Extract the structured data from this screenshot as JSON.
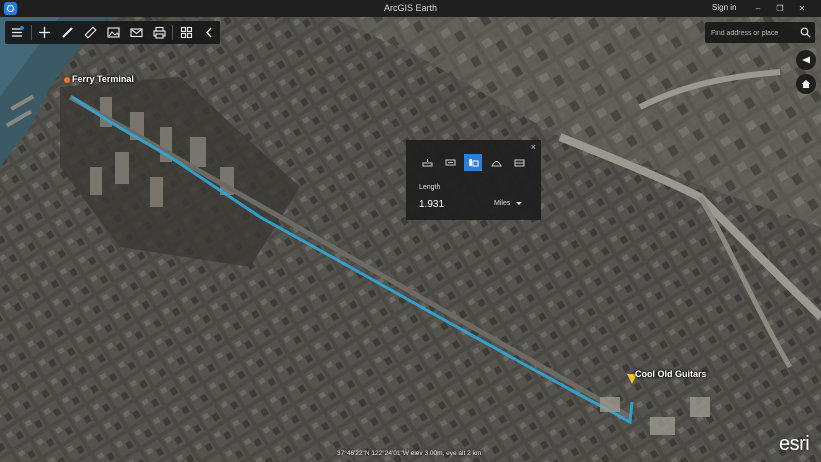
{
  "window": {
    "title": "ArcGIS Earth",
    "sign_in": "Sign in",
    "minimize_glyph": "–",
    "restore_glyph": "❐",
    "close_glyph": "✕"
  },
  "toolbar": {
    "icons": [
      "layers-icon",
      "add-icon",
      "draw-icon",
      "measure-icon",
      "image-icon",
      "mail-icon",
      "print-icon",
      "grid-icon",
      "collapse-icon"
    ]
  },
  "search": {
    "placeholder": "Find address or place"
  },
  "map": {
    "labels": {
      "start": "Ferry Terminal",
      "end": "Cool Old Guitars"
    },
    "route_color": "#2fa8d8",
    "start_pin_color": "#e07a2a",
    "end_pin_color": "#f2c12e"
  },
  "measure": {
    "close_glyph": "×",
    "modes": [
      "horizontal-distance-icon",
      "vertical-distance-icon",
      "path-distance-icon",
      "area-icon",
      "building-icon"
    ],
    "active_mode": 2,
    "length_label": "Length",
    "length_value": "1.931",
    "unit": "Miles"
  },
  "status": {
    "text": "37°46'22\"N  122°24'01\"W  elev 3.00m,  eye alt 2 km"
  },
  "logo": "esri",
  "colors": {
    "accent": "#2d7fd6",
    "panel_bg": "#202020"
  }
}
